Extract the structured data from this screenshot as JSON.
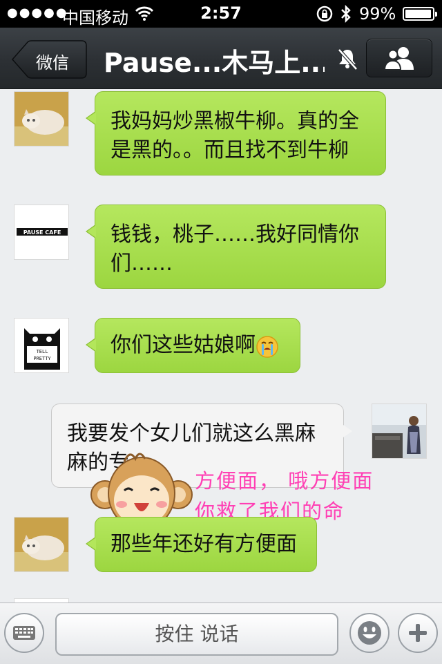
{
  "status_bar": {
    "carrier": "中国移动",
    "time": "2:57",
    "battery_percent": "99%",
    "battery_level": 0.99,
    "signal_bars": 5
  },
  "nav": {
    "back_label": "微信",
    "title": "Pause...木马上..."
  },
  "avatars": {
    "cat_icon": "cat-photo",
    "pause_logo": "PAUSE CAFE",
    "monster_text": "TELL ME I'm PRETTY"
  },
  "messages": [
    {
      "side": "in",
      "avatar": "cat",
      "text": "我妈妈炒黑椒牛柳。真的全是黑的。。而且找不到牛柳"
    },
    {
      "side": "in",
      "avatar": "pause",
      "text": "钱钱，桃子……我好同情你们……"
    },
    {
      "side": "in",
      "avatar": "monster",
      "text": "你们这些姑娘啊",
      "emoji": "crying-face"
    },
    {
      "side": "out",
      "avatar": "woman",
      "text": "我要发个女儿们就这么黑麻麻的专"
    },
    {
      "side": "in",
      "avatar": "cat",
      "text": "那些年还好有方便面"
    }
  ],
  "overlay_caption": {
    "line1": "方便面， 哦方便面",
    "line2": "你救了我们的命",
    "color": "#ff3fb4"
  },
  "input_bar": {
    "hold_to_talk_label": "按住 说话"
  },
  "colors": {
    "incoming_bubble": "#a5dc4a",
    "outgoing_bubble": "#f4f4f4",
    "navbar": "#2c3034"
  }
}
